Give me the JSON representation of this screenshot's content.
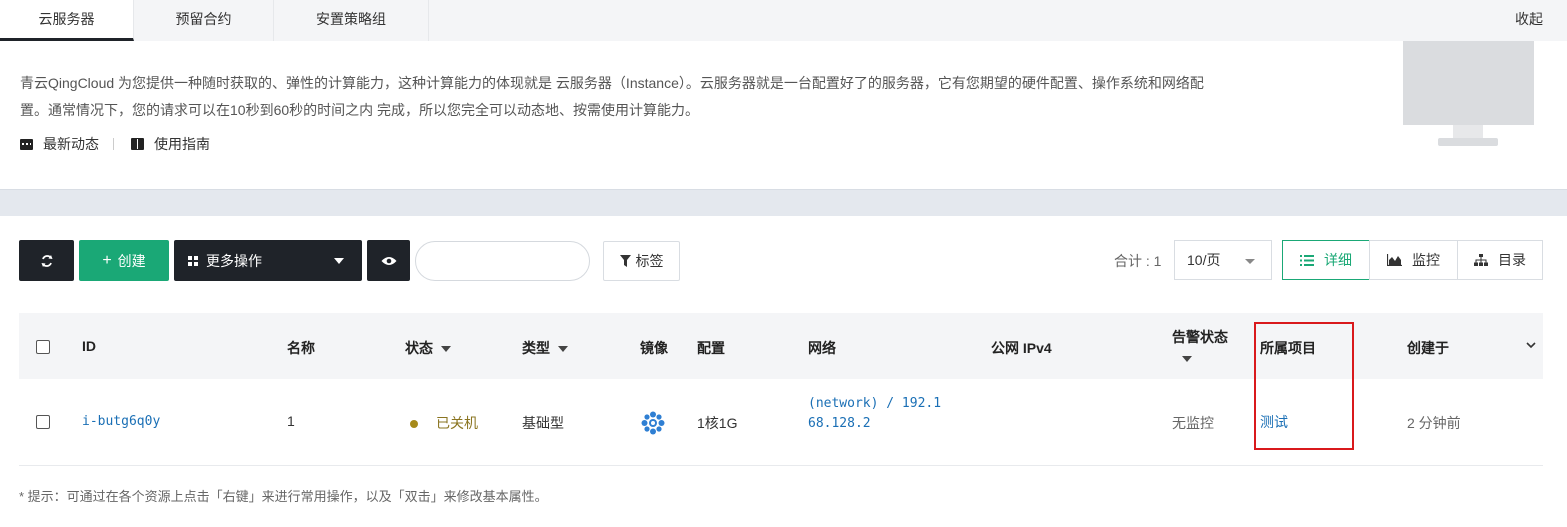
{
  "tabs": [
    {
      "label": "云服务器"
    },
    {
      "label": "预留合约"
    },
    {
      "label": "安置策略组"
    }
  ],
  "collapse_label": "收起",
  "intro": {
    "line1": "青云QingCloud 为您提供一种随时获取的、弹性的计算能力，这种计算能力的体现就是 云服务器（Instance）。云服务器就是一台配置好了的服务器，它有您期望的硬件配置、操作系统和网络配",
    "line2": "置。通常情况下，您的请求可以在10秒到60秒的时间之内 完成，所以您完全可以动态地、按需使用计算能力。",
    "links": [
      "最新动态",
      "使用指南"
    ]
  },
  "toolbar": {
    "create_label": "创建",
    "more_label": "更多操作",
    "tag_label": "标签",
    "search_placeholder": "",
    "total_label": "合计 : 1",
    "page_size": "10/页",
    "views": [
      "详细",
      "监控",
      "目录"
    ]
  },
  "table": {
    "headers": {
      "id": "ID",
      "name": "名称",
      "status": "状态",
      "type": "类型",
      "image": "镜像",
      "config": "配置",
      "network": "网络",
      "public_ip": "公网 IPv4",
      "alarm": "告警状态",
      "project": "所属项目",
      "created": "创建于"
    },
    "rows": [
      {
        "id": "i-butg6q0y",
        "name": "1",
        "status": "已关机",
        "type": "基础型",
        "config": "1核1G",
        "network_line1": "(network) / 192.1",
        "network_line2": "68.128.2",
        "public_ip": "",
        "alarm": "无监控",
        "project": "测试",
        "created": "2 分钟前"
      }
    ]
  },
  "tip": "* 提示：可通过在各个资源上点击「右键」来进行常用操作，以及「双击」来修改基本属性。",
  "colors": {
    "accent_green": "#1aa876",
    "dark_button": "#1f2329",
    "link_blue": "#1a6fb5",
    "status_off": "#a68a1a",
    "highlight_red": "#d9191c"
  }
}
